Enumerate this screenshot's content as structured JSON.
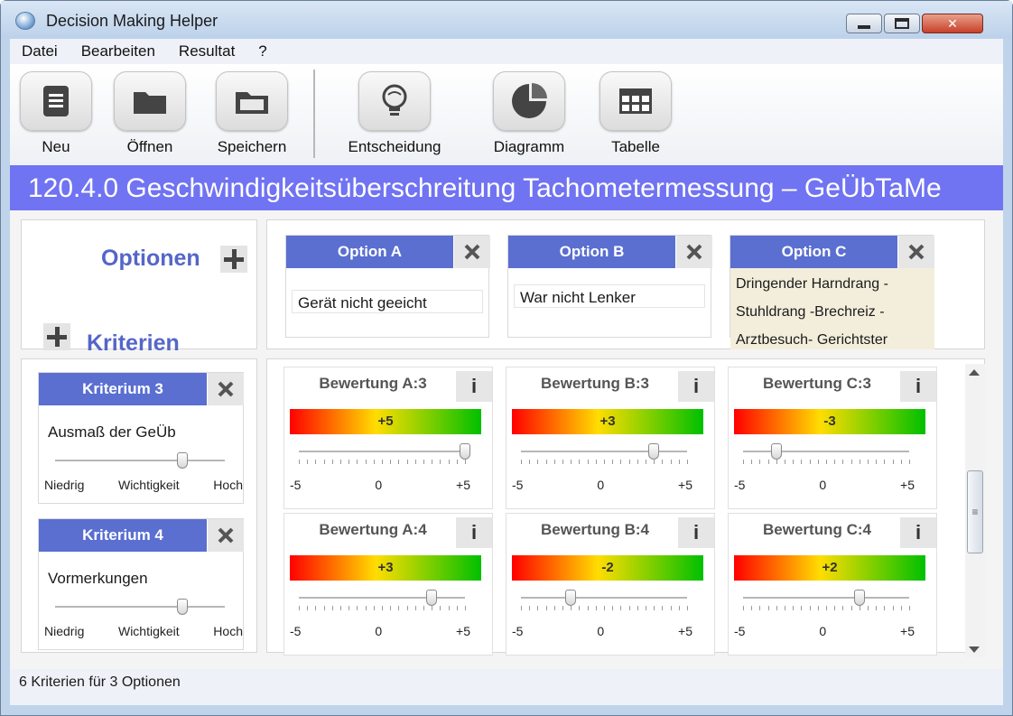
{
  "window": {
    "title": "Decision Making Helper"
  },
  "menu": [
    "Datei",
    "Bearbeiten",
    "Resultat",
    "?"
  ],
  "toolbar": {
    "new": "Neu",
    "open": "Öffnen",
    "save": "Speichern",
    "decision": "Entscheidung",
    "chart": "Diagramm",
    "table": "Tabelle"
  },
  "banner": "120.4.0 Geschwindigkeitsüberschreitung Tachometermessung – GeÜbTaMe",
  "sidebar": {
    "options_label": "Optionen",
    "criteria_label": "Kriterien"
  },
  "options": [
    {
      "label": "Option A",
      "text": "Gerät nicht geeicht"
    },
    {
      "label": "Option B",
      "text": "War nicht Lenker"
    },
    {
      "label": "Option C",
      "text": "Dringender Harndrang -\nStuhldrang -Brechreiz  -\nArztbesuch- Gerichtster"
    }
  ],
  "criteria": [
    {
      "label": "Kriterium 3",
      "text": "Ausmaß der GeÜb",
      "importance": 0.75,
      "low": "Niedrig",
      "mid": "Wichtigkeit",
      "high": "Hoch"
    },
    {
      "label": "Kriterium 4",
      "text": "Vormerkungen",
      "importance": 0.75,
      "low": "Niedrig",
      "mid": "Wichtigkeit",
      "high": "Hoch"
    }
  ],
  "ratings": [
    [
      {
        "title": "Bewertung A:3",
        "value": "+5",
        "num": 5
      },
      {
        "title": "Bewertung B:3",
        "value": "+3",
        "num": 3
      },
      {
        "title": "Bewertung C:3",
        "value": "-3",
        "num": -3
      }
    ],
    [
      {
        "title": "Bewertung A:4",
        "value": "+3",
        "num": 3
      },
      {
        "title": "Bewertung B:4",
        "value": "-2",
        "num": -2
      },
      {
        "title": "Bewertung C:4",
        "value": "+2",
        "num": 2
      }
    ]
  ],
  "scale": {
    "min": "-5",
    "mid": "0",
    "max": "+5"
  },
  "status": "6 Kriterien für 3 Optionen",
  "colors": {
    "banner": "#7073f2",
    "header": "#5a6fd0",
    "label": "#5566c8"
  }
}
